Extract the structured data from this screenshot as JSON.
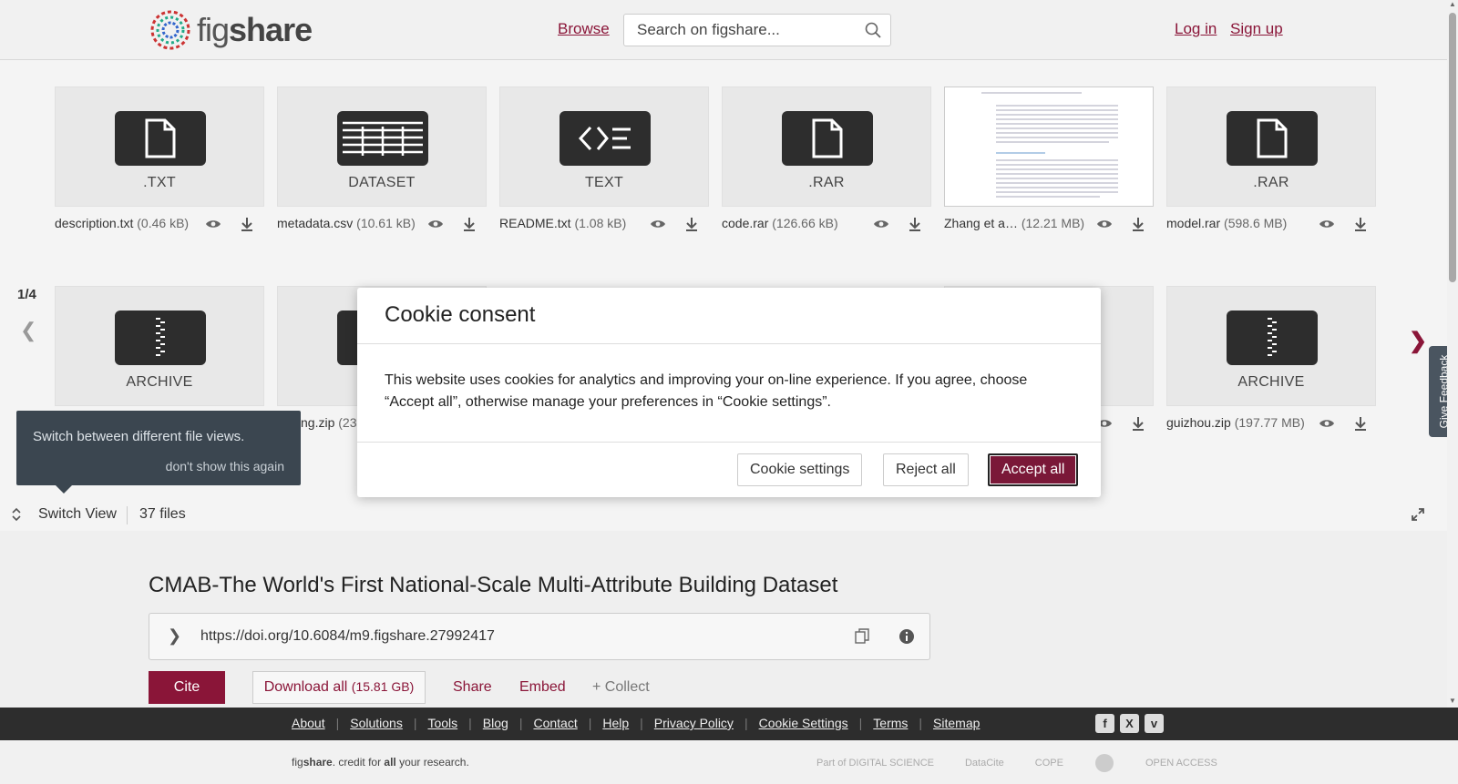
{
  "header": {
    "logo_text": "figshare",
    "browse": "Browse",
    "search_placeholder": "Search on figshare...",
    "login": "Log in",
    "signup": "Sign up"
  },
  "files_row1": [
    {
      "type": "TXT",
      "type_label": ".TXT",
      "name": "description.txt",
      "size": "(0.46 kB)"
    },
    {
      "type": "DATASET",
      "type_label": "DATASET",
      "name": "metadata.csv",
      "size": "(10.61 kB)"
    },
    {
      "type": "TEXT",
      "type_label": "TEXT",
      "name": "README.txt",
      "size": "(1.08 kB)"
    },
    {
      "type": "RAR",
      "type_label": ".RAR",
      "name": "code.rar",
      "size": "(126.66 kB)"
    },
    {
      "type": "PDF",
      "type_label": "",
      "name": "Zhang et a…",
      "size": "(12.21 MB)"
    },
    {
      "type": "RAR",
      "type_label": ".RAR",
      "name": "model.rar",
      "size": "(598.6 MB)"
    }
  ],
  "files_row2": [
    {
      "type_label": "ARCHIVE",
      "name": "",
      "size": ""
    },
    {
      "type_label": "A",
      "name": "ng.zip",
      "size": "(23"
    },
    {
      "type_label": "ARCHIVE",
      "name": "guizhou.zip",
      "size": "(197.77 MB)"
    }
  ],
  "viewer": {
    "page_indicator": "1/4",
    "tooltip_text": "Switch between different file views.",
    "tooltip_dismiss": "don't show this again",
    "switch_view": "Switch View",
    "file_count": "37 files",
    "feedback": "Give Feedback"
  },
  "article": {
    "title": "CMAB-The World's First National-Scale Multi-Attribute Building Dataset",
    "doi": "https://doi.org/10.6084/m9.figshare.27992417",
    "cite": "Cite",
    "download_all": "Download all",
    "download_size": "(15.81 GB)",
    "share": "Share",
    "embed": "Embed",
    "collect": "+ Collect"
  },
  "footer": {
    "links": [
      "About",
      "Solutions",
      "Tools",
      "Blog",
      "Contact",
      "Help",
      "Privacy Policy",
      "Cookie Settings",
      "Terms",
      "Sitemap"
    ],
    "tagline_pre": "fig",
    "tagline_bold": "share",
    "tagline_mid": ". credit for ",
    "tagline_all": "all",
    "tagline_post": " your research.",
    "partners": [
      "Part of DIGITAL SCIENCE",
      "DataCite",
      "COPE",
      "",
      "OPEN ACCESS"
    ]
  },
  "cookie_modal": {
    "title": "Cookie consent",
    "body": "This website uses cookies for analytics and improving your on-line experience. If you agree, choose “Accept all”, otherwise manage your preferences in “Cookie settings”.",
    "settings": "Cookie settings",
    "reject": "Reject all",
    "accept": "Accept all"
  },
  "colors": {
    "accent": "#8a1538",
    "dark_tile": "#2d2d2d",
    "footer_bg": "#2d2d2d"
  }
}
